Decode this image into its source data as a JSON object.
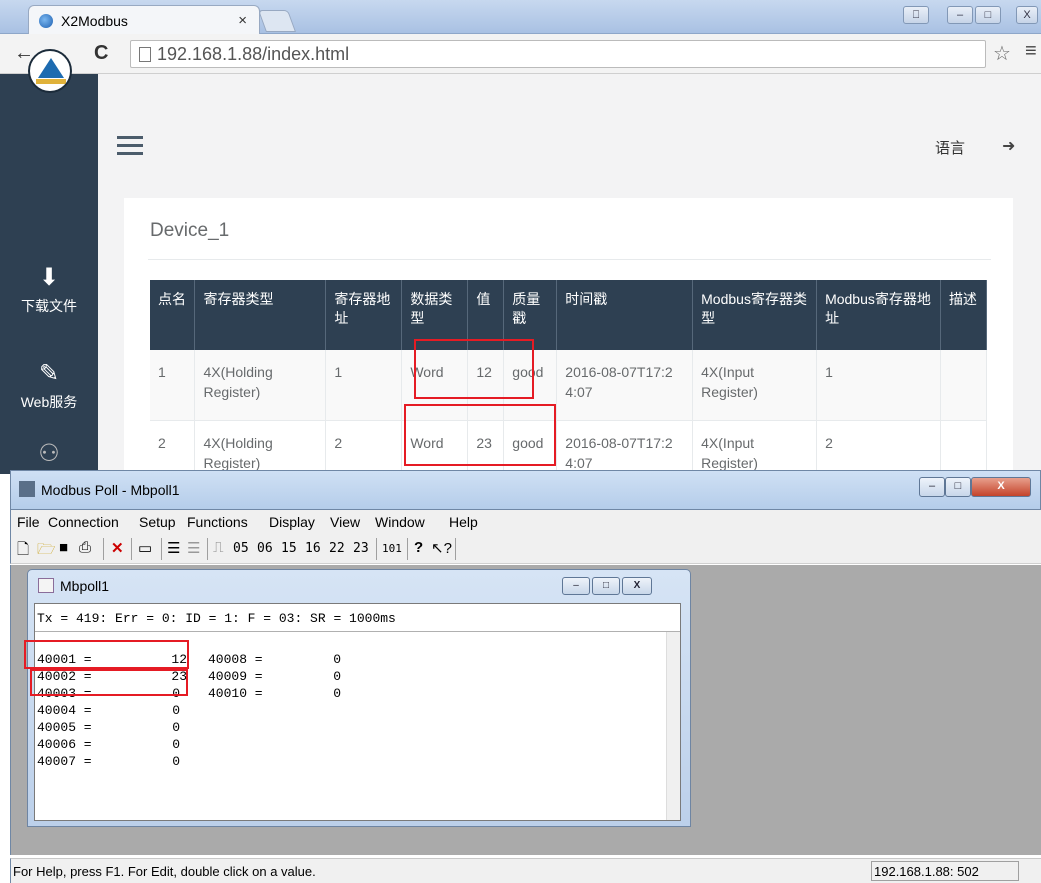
{
  "browser": {
    "tab_title": "X2Modbus",
    "tab_close": "×",
    "url": "192.168.1.88/index.html",
    "nav": {
      "back": "←",
      "forward": "→",
      "reload": "C"
    },
    "star": "☆",
    "menu": "≡",
    "window_controls": [
      "⎕",
      "–",
      "□",
      "X"
    ]
  },
  "web": {
    "sidebar": [
      {
        "icon": "download-icon",
        "glyph": "⬇",
        "label": "下载文件"
      },
      {
        "icon": "wrench-icon",
        "glyph": "✎",
        "label": "Web服务"
      },
      {
        "icon": "users-icon",
        "glyph": "⚇",
        "label": ""
      }
    ],
    "header": {
      "language": "语言",
      "logout_glyph": "➜"
    },
    "device_title": "Device_1",
    "table": {
      "headers": [
        "点名",
        "寄存器类型",
        "寄存器地址",
        "数据类型",
        "值",
        "质量戳",
        "时间戳",
        "Modbus寄存器类型",
        "Modbus寄存器地址",
        "描述"
      ],
      "rows": [
        [
          "1",
          "4X(Holding Register)",
          "1",
          "Word",
          "12",
          "good",
          "2016-08-07T17:24:07",
          "4X(Input Register)",
          "1",
          ""
        ],
        [
          "2",
          "4X(Holding Register)",
          "2",
          "Word",
          "23",
          "good",
          "2016-08-07T17:24:07",
          "4X(Input Register)",
          "2",
          ""
        ]
      ]
    }
  },
  "modbus_poll": {
    "title": "Modbus Poll - Mbpoll1",
    "menus": [
      "File",
      "Connection",
      "Setup",
      "Functions",
      "Display",
      "View",
      "Window",
      "Help"
    ],
    "toolbar_numbers": [
      "05",
      "06",
      "15",
      "16",
      "22",
      "23",
      "101"
    ],
    "window_buttons": [
      "–",
      "□",
      "X"
    ],
    "child": {
      "title": "Mbpoll1",
      "status_line": "Tx = 419: Err = 0: ID = 1: F = 03: SR = 1000ms",
      "registers_col1": [
        {
          "addr": "40001 =",
          "value": "12"
        },
        {
          "addr": "40002 =",
          "value": "23"
        },
        {
          "addr": "40003 =",
          "value": "0"
        },
        {
          "addr": "40004 =",
          "value": "0"
        },
        {
          "addr": "40005 =",
          "value": "0"
        },
        {
          "addr": "40006 =",
          "value": "0"
        },
        {
          "addr": "40007 =",
          "value": "0"
        }
      ],
      "registers_col2": [
        {
          "addr": "40008 =",
          "value": "0"
        },
        {
          "addr": "40009 =",
          "value": "0"
        },
        {
          "addr": "40010 =",
          "value": "0"
        }
      ]
    },
    "status_help": "For Help, press F1.  For Edit, double click on a value.",
    "status_address": "192.168.1.88: 502"
  },
  "colors": {
    "sidebar": "#2e4052",
    "highlight_box": "#e51b24",
    "mdi_background": "#aaaaaa"
  }
}
